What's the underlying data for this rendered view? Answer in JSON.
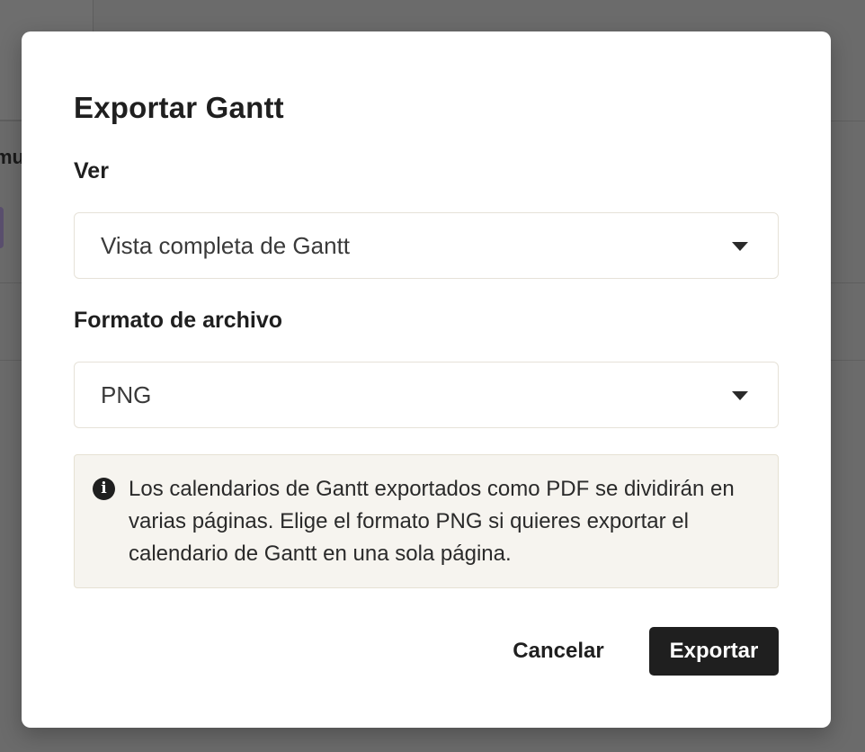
{
  "background": {
    "partial_text": "mu"
  },
  "dialog": {
    "title": "Exportar Gantt",
    "view": {
      "label": "Ver",
      "selected": "Vista completa de Gantt"
    },
    "format": {
      "label": "Formato de archivo",
      "selected": "PNG"
    },
    "info": {
      "icon": "info-icon",
      "text": "Los calendarios de Gantt exportados como PDF se dividirán en varias páginas. Elige el formato PNG si quieres exportar el calendario de Gantt en una sola página."
    },
    "buttons": {
      "cancel": "Cancelar",
      "export": "Exportar"
    }
  },
  "colors": {
    "overlay": "#6b6b6b",
    "primary_button": "#1f1f1f",
    "info_background": "#f6f4ef"
  }
}
